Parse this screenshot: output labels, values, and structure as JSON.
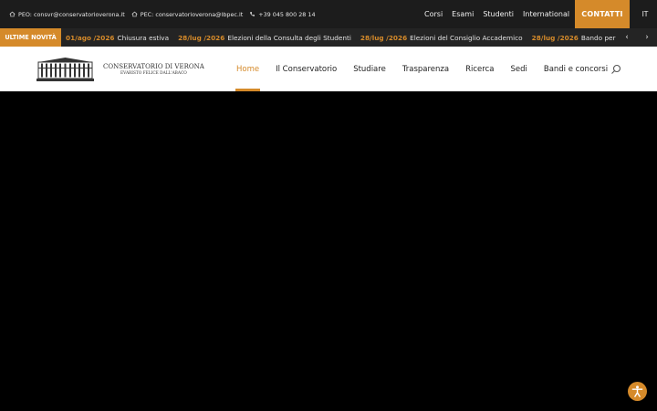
{
  "topbar": {
    "contacts": [
      {
        "icon": "home-icon",
        "text": "PEO: consvr@conservatorioverona.it"
      },
      {
        "icon": "home-icon",
        "text": "PEC: conservatorioverona@lbpec.it"
      },
      {
        "icon": "phone-icon",
        "text": "+39 045 800 28 14"
      }
    ],
    "links": [
      "Corsi",
      "Esami",
      "Studenti",
      "International"
    ],
    "cta": "CONTATTI",
    "language": "IT"
  },
  "ticker": {
    "label": "ULTIME NOVITÀ",
    "items": [
      {
        "date": "01/ago /2026",
        "title": "Chiusura estiva"
      },
      {
        "date": "28/lug /2026",
        "title": "Elezioni della Consulta degli Studenti"
      },
      {
        "date": "28/lug /2026",
        "title": "Elezioni del Consiglio Accademico"
      },
      {
        "date": "28/lug /2026",
        "title": "Bando per musicisti/e esterni"
      }
    ],
    "prev": "‹",
    "next": "›"
  },
  "header": {
    "logo_line1": "CONSERVATORIO DI VERONA",
    "logo_line2": "EVARISTO FELICE DALL'ABACO",
    "nav": [
      "Home",
      "Il Conservatorio",
      "Studiare",
      "Trasparenza",
      "Ricerca",
      "Sedi",
      "Bandi e concorsi"
    ],
    "active": "Home"
  },
  "colors": {
    "accent": "#d58a2a",
    "topbar": "#1c1c1c",
    "ticker": "#242424"
  }
}
